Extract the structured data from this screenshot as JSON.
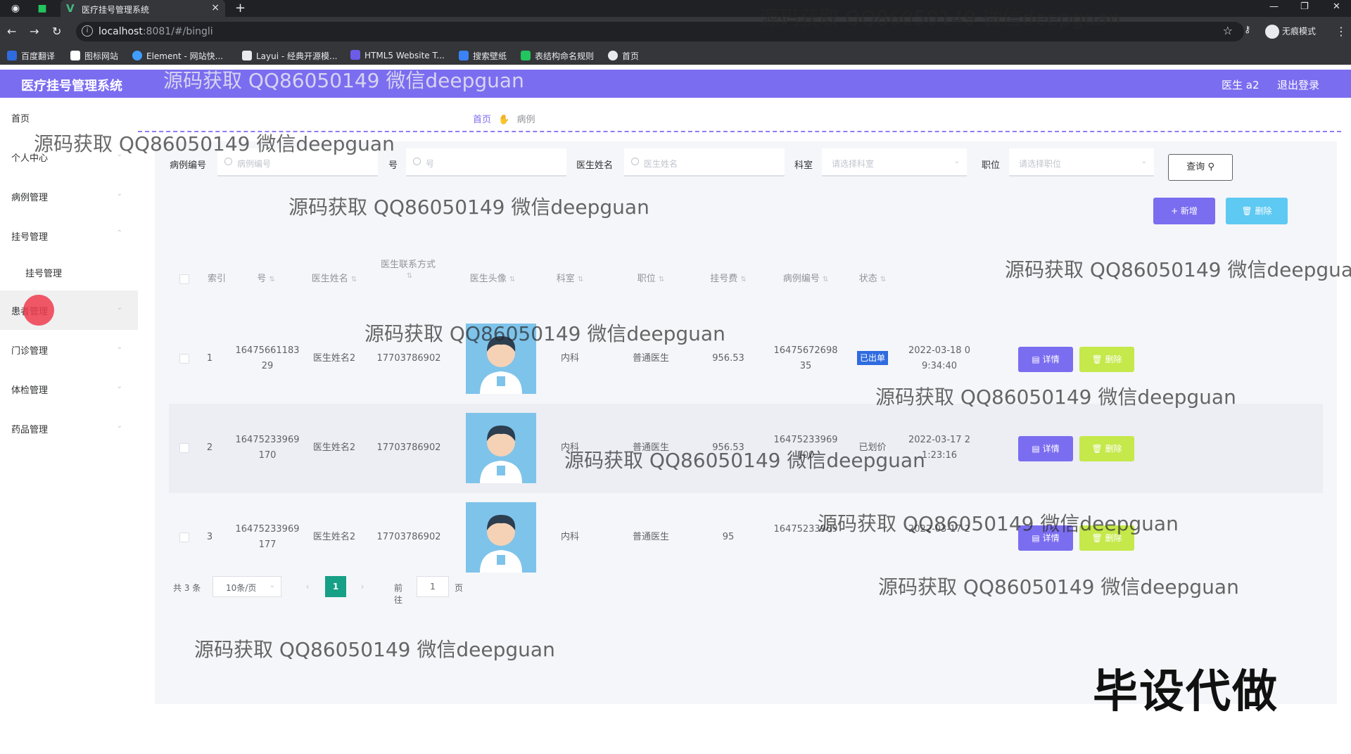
{
  "browser": {
    "tab_title": "医疗挂号管理系统",
    "url_host": "localhost",
    "url_path": ":8081/#/bingli",
    "incognito_label": "无痕模式",
    "bookmarks": [
      {
        "label": "百度翻译",
        "color": "#2f6be0"
      },
      {
        "label": "图标网站",
        "color": "#ffffff"
      },
      {
        "label": "Element - 网站快...",
        "color": "#409eff"
      },
      {
        "label": "Layui - 经典开源模...",
        "color": "#e8eaed"
      },
      {
        "label": "HTML5 Website T...",
        "color": "#6c5ce7"
      },
      {
        "label": "搜索壁纸",
        "color": "#3b82f6"
      },
      {
        "label": "表结构命名规则",
        "color": "#22c55e"
      },
      {
        "label": "首页",
        "color": "#e8eaed"
      }
    ]
  },
  "header": {
    "title": "医疗挂号管理系统",
    "user": "医生 a2",
    "logout": "退出登录"
  },
  "sidebar": {
    "items": [
      {
        "label": "首页",
        "has_arrow": false
      },
      {
        "label": "个人中心",
        "has_arrow": true
      },
      {
        "label": "病例管理",
        "has_arrow": true
      },
      {
        "label": "挂号管理",
        "has_arrow": true
      },
      {
        "label": "挂号管理",
        "has_arrow": false,
        "sub": true
      },
      {
        "label": "患者管理",
        "has_arrow": true
      },
      {
        "label": "门诊管理",
        "has_arrow": true
      },
      {
        "label": "体检管理",
        "has_arrow": true
      },
      {
        "label": "药品管理",
        "has_arrow": true
      }
    ]
  },
  "breadcrumb": {
    "home": "首页",
    "current": "病例"
  },
  "search": {
    "case_no_label": "病例编号",
    "case_no_placeholder": "病例编号",
    "no_label": "号",
    "no_placeholder": "号",
    "doctor_label": "医生姓名",
    "doctor_placeholder": "医生姓名",
    "dept_label": "科室",
    "dept_placeholder": "请选择科室",
    "position_label": "职位",
    "position_placeholder": "请选择职位",
    "query_button": "查询"
  },
  "actions": {
    "add": "+ 新增",
    "batch_delete": "删除"
  },
  "table": {
    "headers": [
      "索引",
      "号",
      "医生姓名",
      "医生联系方式",
      "医生头像",
      "科室",
      "职位",
      "挂号费",
      "病例编号",
      "状态"
    ],
    "rows": [
      {
        "index": "1",
        "no": "16475661183\n29",
        "doctor": "医生姓名2",
        "phone": "17703786902",
        "dept": "内科",
        "position": "普通医生",
        "fee": "956.53",
        "case_no": "16475672698\n35",
        "status": "已出单",
        "status_highlight": true,
        "time": "2022-03-18 0\n9:34:40",
        "detail": "详情",
        "delete": "删除"
      },
      {
        "index": "2",
        "no": "16475233969\n170",
        "doctor": "医生姓名2",
        "phone": "17703786902",
        "dept": "内科",
        "position": "普通医生",
        "fee": "956.53",
        "case_no": "16475233969\n100",
        "status": "已划价",
        "status_highlight": false,
        "time": "2022-03-17 2\n1:23:16",
        "detail": "详情",
        "delete": "删除"
      },
      {
        "index": "3",
        "no": "16475233969\n177",
        "doctor": "医生姓名2",
        "phone": "17703786902",
        "dept": "内科",
        "position": "普通医生",
        "fee": "95",
        "case_no": "16475233969\n",
        "status": "",
        "status_highlight": false,
        "time": "2022-03-17 2\n",
        "detail": "详情",
        "delete": "删除"
      }
    ]
  },
  "pagination": {
    "total": "共 3 条",
    "page_size": "10条/页",
    "current_page": "1",
    "goto_label": "前往",
    "goto_value": "1",
    "page_unit": "页"
  },
  "watermarks": {
    "text": "源码获取 QQ86050149 微信deepguan",
    "stamp": "毕设代做"
  }
}
